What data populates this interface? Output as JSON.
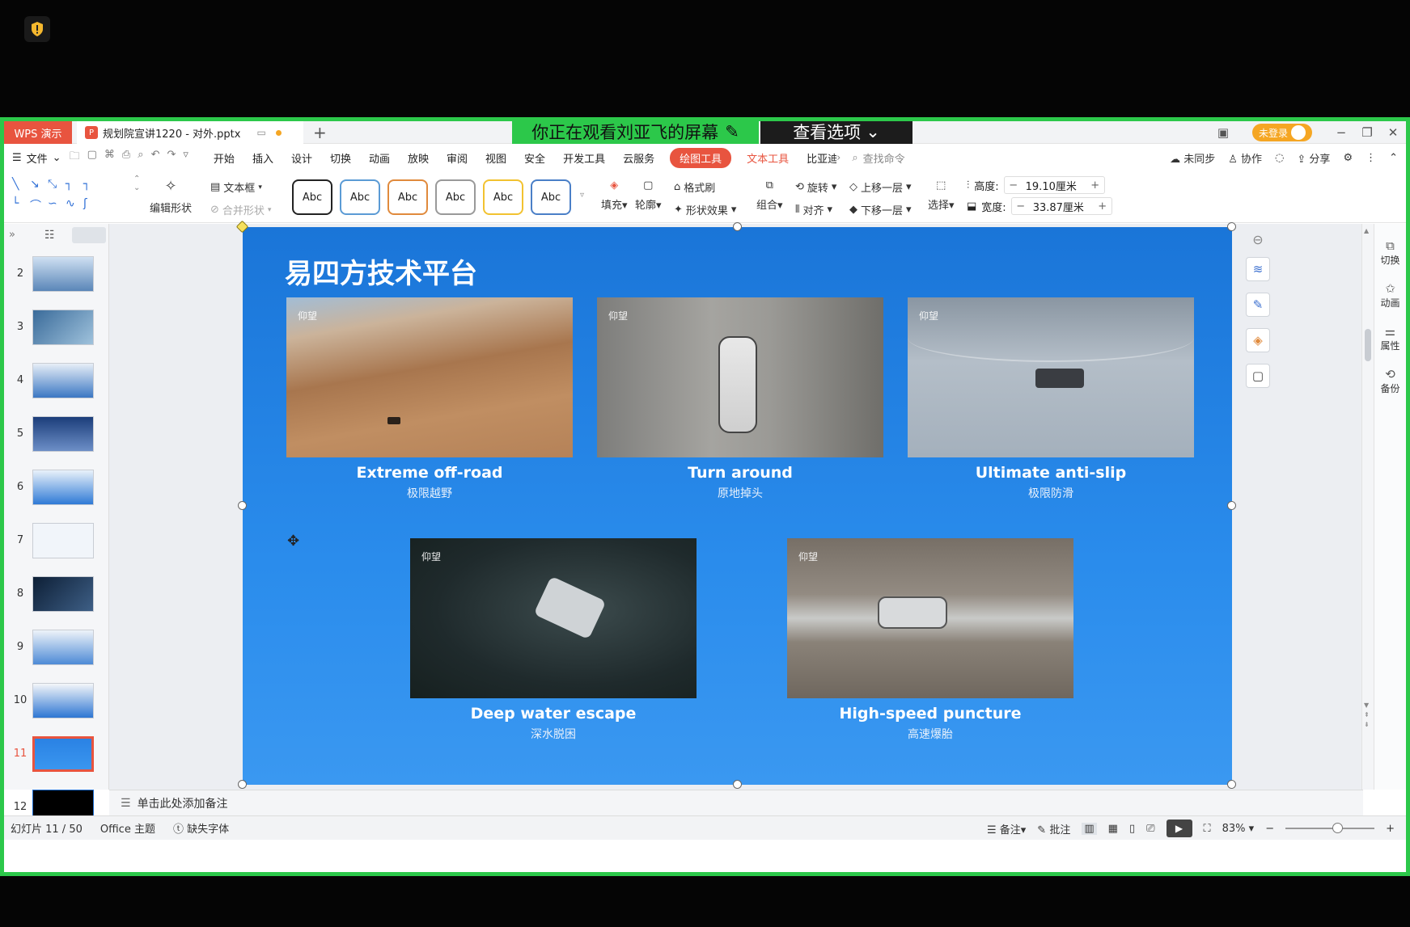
{
  "titlebar": {
    "app_name": "WPS 演示",
    "doc_title": "规划院宣讲1220 - 对外.pptx",
    "new_tab": "+",
    "watching_banner": "你正在观看刘亚飞的屏幕",
    "view_options": "查看选项",
    "login": "未登录"
  },
  "menu": {
    "file": "文件",
    "items": [
      "开始",
      "插入",
      "设计",
      "切换",
      "动画",
      "放映",
      "审阅",
      "视图",
      "安全",
      "开发工具",
      "云服务"
    ],
    "draw_tool": "绘图工具",
    "text_tool": "文本工具",
    "cut_item": "比亚迪",
    "search_placeholder": "查找命令",
    "sync": "未同步",
    "collab": "协作",
    "share": "分享"
  },
  "ribbon": {
    "edit_shape": "编辑形状",
    "text_box": "文本框",
    "merge_shape": "合并形状",
    "style_label": "Abc",
    "fill": "填充",
    "outline": "轮廓",
    "format_painter": "格式刷",
    "shape_effects": "形状效果",
    "group": "组合",
    "rotate": "旋转",
    "align": "对齐",
    "bring_forward": "上移一层",
    "send_backward": "下移一层",
    "select": "选择",
    "height_label": "高度:",
    "height_value": "19.10厘米",
    "width_label": "宽度:",
    "width_value": "33.87厘米"
  },
  "thumbnails": [
    "2",
    "3",
    "4",
    "5",
    "6",
    "7",
    "8",
    "9",
    "10",
    "11",
    "12"
  ],
  "active_slide": "11",
  "slide": {
    "title": "易四方技术平台",
    "brand": "仰望",
    "cards": [
      {
        "en": "Extreme off-road",
        "zh": "极限越野"
      },
      {
        "en": "Turn around",
        "zh": "原地掉头"
      },
      {
        "en": "Ultimate anti-slip",
        "zh": "极限防滑"
      },
      {
        "en": "Deep water escape",
        "zh": "深水脱困"
      },
      {
        "en": "High-speed puncture",
        "zh": "高速爆胎"
      }
    ]
  },
  "right_panel": [
    "切换",
    "动画",
    "属性",
    "备份"
  ],
  "notes_placeholder": "单击此处添加备注",
  "status": {
    "slide_count": "幻灯片 11 / 50",
    "theme": "Office 主题",
    "missing_font": "缺失字体",
    "notes": "备注",
    "comments": "批注",
    "zoom": "83%"
  }
}
